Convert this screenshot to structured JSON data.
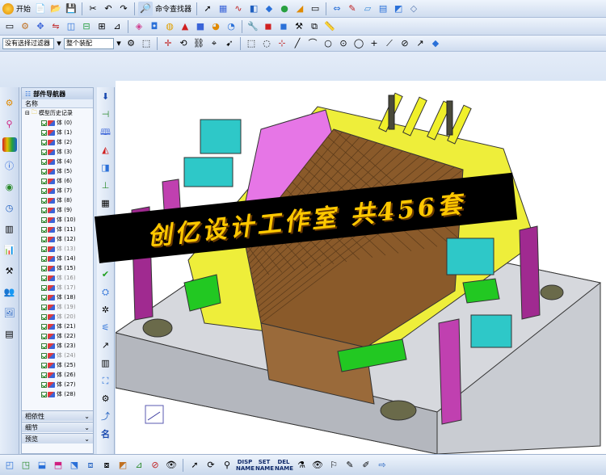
{
  "menu": {
    "start_label": "开始",
    "command_finder_label": "命令查找器"
  },
  "filter_bar": {
    "selection_filter": "没有选择过滤器",
    "assembly_scope": "整个装配"
  },
  "navigator": {
    "title": "部件导航器",
    "column_name": "名称",
    "history_label": "模型历史记录",
    "items": [
      {
        "label": "体 (0)",
        "dimmed": false
      },
      {
        "label": "体 (1)",
        "dimmed": false
      },
      {
        "label": "体 (2)",
        "dimmed": false
      },
      {
        "label": "体 (3)",
        "dimmed": false
      },
      {
        "label": "体 (4)",
        "dimmed": false
      },
      {
        "label": "体 (5)",
        "dimmed": false
      },
      {
        "label": "体 (6)",
        "dimmed": false
      },
      {
        "label": "体 (7)",
        "dimmed": false
      },
      {
        "label": "体 (8)",
        "dimmed": false
      },
      {
        "label": "体 (9)",
        "dimmed": false
      },
      {
        "label": "体 (10)",
        "dimmed": false
      },
      {
        "label": "体 (11)",
        "dimmed": false
      },
      {
        "label": "体 (12)",
        "dimmed": false
      },
      {
        "label": "体 (13)",
        "dimmed": true
      },
      {
        "label": "体 (14)",
        "dimmed": false
      },
      {
        "label": "体 (15)",
        "dimmed": false
      },
      {
        "label": "体 (16)",
        "dimmed": true
      },
      {
        "label": "体 (17)",
        "dimmed": true
      },
      {
        "label": "体 (18)",
        "dimmed": false
      },
      {
        "label": "体 (19)",
        "dimmed": true
      },
      {
        "label": "体 (20)",
        "dimmed": true
      },
      {
        "label": "体 (21)",
        "dimmed": false
      },
      {
        "label": "体 (22)",
        "dimmed": false
      },
      {
        "label": "体 (23)",
        "dimmed": false
      },
      {
        "label": "体 (24)",
        "dimmed": true
      },
      {
        "label": "体 (25)",
        "dimmed": false
      },
      {
        "label": "体 (26)",
        "dimmed": false
      },
      {
        "label": "体 (27)",
        "dimmed": false
      },
      {
        "label": "体 (28)",
        "dimmed": false
      }
    ],
    "sections": [
      "相依性",
      "细节",
      "预览"
    ]
  },
  "banner": {
    "text": "创亿设计工作室 共456套"
  },
  "bottom_bar": {
    "disp_name": "DISP NAME",
    "set_name": "SET NAME",
    "del_name": "DEL NAME"
  },
  "side_label": "名",
  "colors": {
    "banner_bg": "#000000",
    "banner_text": "#ffc800",
    "mold_base": "#c9ccd2",
    "plate_yellow": "#eeee3a",
    "plate_magenta": "#e676e6",
    "cyan_block": "#2ec8c8",
    "green_block": "#22c822",
    "purple_pillar": "#a02a90"
  }
}
